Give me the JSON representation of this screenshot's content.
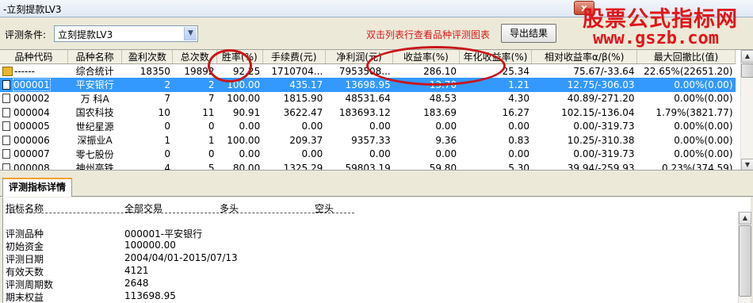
{
  "window": {
    "title": "-立刻提款LV3",
    "close_label": "x"
  },
  "watermark": {
    "line1": "股票公式指标网",
    "line2": "www.gszb.com"
  },
  "toolbar": {
    "condition_label": "评测条件:",
    "condition_value": "立刻提款LV3",
    "hint": "双击列表行查看品种评测图表",
    "export_label": "导出结果"
  },
  "table": {
    "columns": [
      "品种代码",
      "品种名称",
      "盈利次数",
      "总次数",
      "胜率(%)",
      "手续费(元)",
      "净利润(元)",
      "收益率(%)",
      "年化收益率(%)",
      "相对收益率α/β(%)",
      "最大回撤比(值)"
    ],
    "rows": [
      {
        "icon": "summary-icon",
        "code": "------",
        "name": "综合统计",
        "wins": "18350",
        "total": "19892",
        "winrate": "92.25",
        "fee": "1710704...",
        "profit": "7953508...",
        "return": "286.10",
        "annual": "25.34",
        "relative": "75.67/-33.64",
        "drawdown": "22.65%(22651.20)"
      },
      {
        "icon": "document-icon",
        "code": "000001",
        "name": "平安银行",
        "wins": "2",
        "total": "2",
        "winrate": "100.00",
        "fee": "435.17",
        "profit": "13698.95",
        "return": "13.70",
        "annual": "1.21",
        "relative": "12.75/-306.03",
        "drawdown": "0.00%(0.00)",
        "selected": true
      },
      {
        "icon": "document-icon",
        "code": "000002",
        "name": "万  科A",
        "wins": "7",
        "total": "7",
        "winrate": "100.00",
        "fee": "1815.90",
        "profit": "48531.64",
        "return": "48.53",
        "annual": "4.30",
        "relative": "40.89/-271.20",
        "drawdown": "0.00%(0.00)"
      },
      {
        "icon": "document-icon",
        "code": "000004",
        "name": "国农科技",
        "wins": "10",
        "total": "11",
        "winrate": "90.91",
        "fee": "3622.47",
        "profit": "183693.12",
        "return": "183.69",
        "annual": "16.27",
        "relative": "102.15/-136.04",
        "drawdown": "1.79%(3821.77)"
      },
      {
        "icon": "document-icon",
        "code": "000005",
        "name": "世纪星源",
        "wins": "0",
        "total": "0",
        "winrate": "0.00",
        "fee": "0.00",
        "profit": "0.00",
        "return": "0.00",
        "annual": "0.00",
        "relative": "0.00/-319.73",
        "drawdown": "0.00%(0.00)"
      },
      {
        "icon": "document-icon",
        "code": "000006",
        "name": "深振业A",
        "wins": "1",
        "total": "1",
        "winrate": "100.00",
        "fee": "209.37",
        "profit": "9357.33",
        "return": "9.36",
        "annual": "0.83",
        "relative": "10.25/-310.38",
        "drawdown": "0.00%(0.00)"
      },
      {
        "icon": "document-icon",
        "code": "000007",
        "name": "零七股份",
        "wins": "0",
        "total": "0",
        "winrate": "0.00",
        "fee": "0.00",
        "profit": "0.00",
        "return": "0.00",
        "annual": "0.00",
        "relative": "0.00/-319.73",
        "drawdown": "0.00%(0.00)"
      },
      {
        "icon": "document-icon",
        "code": "000008",
        "name": "神州高铁",
        "wins": "4",
        "total": "5",
        "winrate": "80.00",
        "fee": "1325.29",
        "profit": "59803.19",
        "return": "59.80",
        "annual": "5.30",
        "relative": "39.94/-259.93",
        "drawdown": "0.23%(374.59)"
      }
    ]
  },
  "detail_tab": {
    "label": "评测指标详情"
  },
  "detail": {
    "headers": [
      "指标名称",
      "全部交易",
      "多头",
      "空头"
    ],
    "rows": [
      {
        "label": "评测品种",
        "value": "000001-平安银行"
      },
      {
        "label": "初始资金",
        "value": "100000.00"
      },
      {
        "label": "评测日期",
        "value": "2004/04/01-2015/07/13"
      },
      {
        "label": "有效天数",
        "value": "4121"
      },
      {
        "label": "评测周期数",
        "value": "2648"
      },
      {
        "label": "期末权益",
        "value": "113698.95"
      }
    ]
  },
  "colors": {
    "annotation": "#c8161a",
    "selection": "#3399ff",
    "hint": "#d41b1b",
    "watermark": "#e0161b"
  }
}
